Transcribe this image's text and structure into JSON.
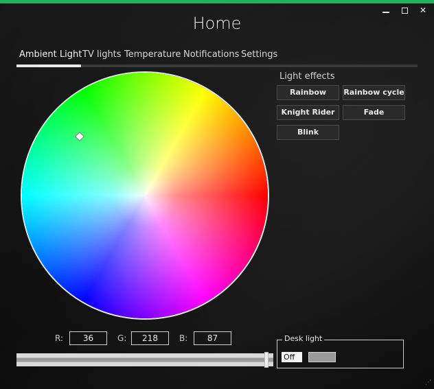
{
  "window": {
    "title": "Home",
    "accent_color": "#1fb25a",
    "controls": {
      "minimize": "minimize-icon",
      "maximize": "maximize-icon",
      "close": "close-icon"
    }
  },
  "tabs": [
    {
      "label": "Ambient Light",
      "active": true
    },
    {
      "label": "TV lights",
      "active": false
    },
    {
      "label": "Temperature",
      "active": false
    },
    {
      "label": "Notifications",
      "active": false
    },
    {
      "label": "Settings",
      "active": false
    }
  ],
  "effects": {
    "label": "Light effects",
    "buttons": [
      "Rainbow",
      "Rainbow cycle",
      "Knight Rider",
      "Fade",
      "Blink"
    ]
  },
  "rgb": {
    "r_label": "R:",
    "r_value": "36",
    "g_label": "G:",
    "g_value": "218",
    "b_label": "B:",
    "b_value": "87"
  },
  "brightness_slider": {
    "value_fraction": 0.98
  },
  "desk_light": {
    "label": "Desk light",
    "state": "Off"
  },
  "icons": {
    "resize_grip": "resize-grip-icon"
  }
}
